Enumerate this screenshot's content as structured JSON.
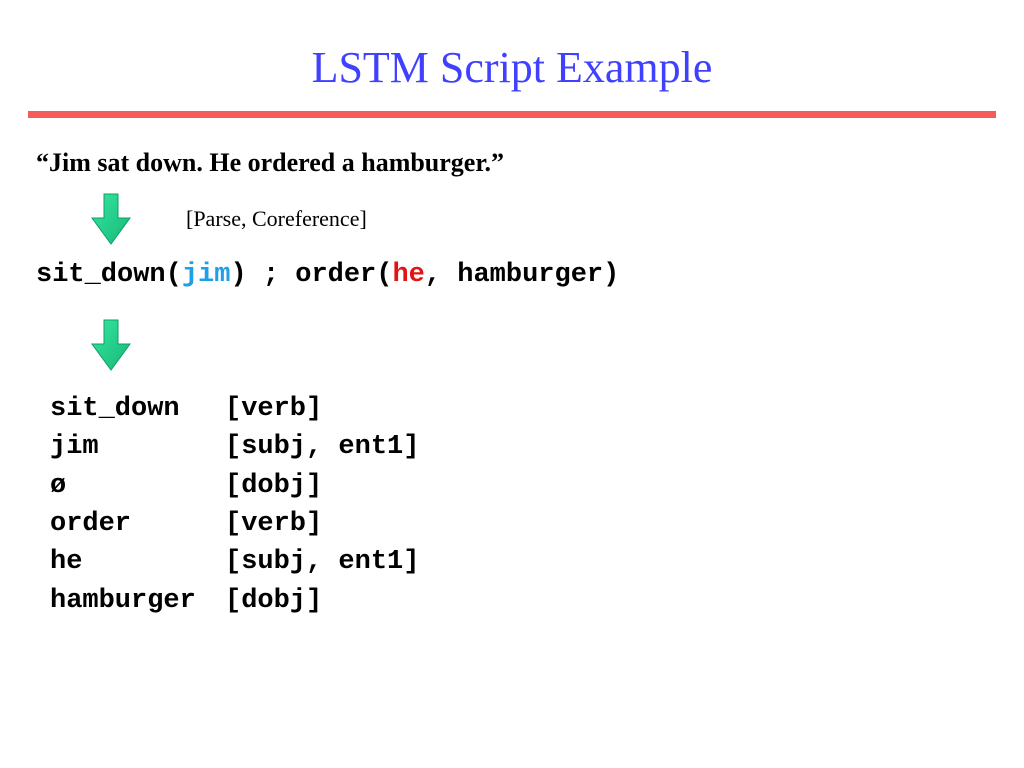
{
  "title": "LSTM Script Example",
  "sentence": "“Jim sat down. He ordered a hamburger.”",
  "annotation": "[Parse, Coreference]",
  "code": {
    "p1": "sit_down(",
    "jim": "jim",
    "p2": ") ; order(",
    "he": "he",
    "p3": ", hamburger)"
  },
  "rows": [
    {
      "token": "sit_down",
      "tags": "[verb]"
    },
    {
      "token": "jim",
      "tags": "[subj, ent1]"
    },
    {
      "token": "ø",
      "tags": "[dobj]"
    },
    {
      "token": "order",
      "tags": "[verb]"
    },
    {
      "token": "he",
      "tags": "[subj, ent1]"
    },
    {
      "token": "hamburger",
      "tags": "[dobj]"
    }
  ]
}
